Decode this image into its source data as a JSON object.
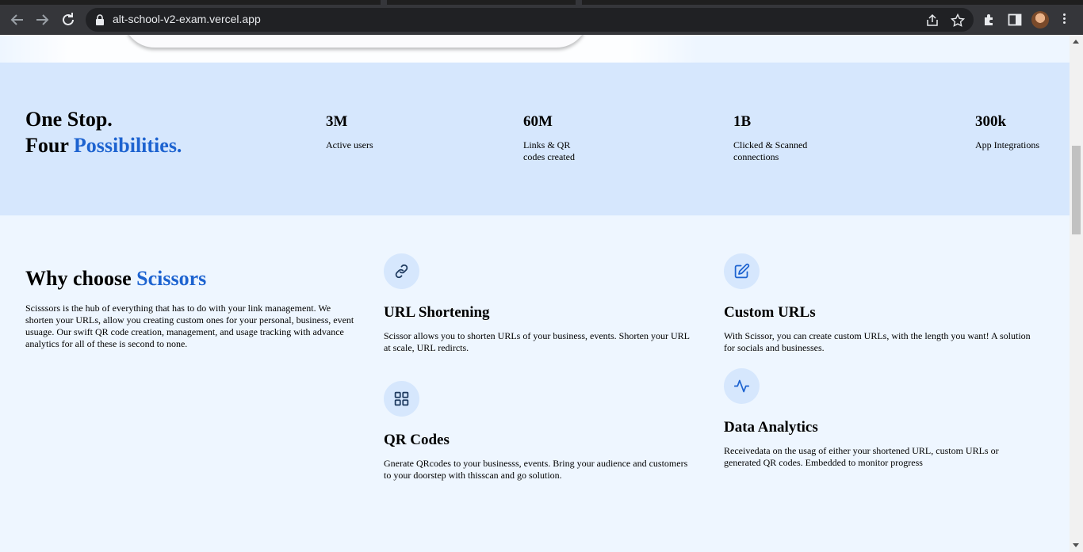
{
  "browser": {
    "url": "alt-school-v2-exam.vercel.app",
    "back_icon": "arrow-left-icon",
    "forward_icon": "arrow-right-icon",
    "reload_icon": "reload-icon"
  },
  "stats": {
    "headline_line1": "One Stop.",
    "headline_line2_prefix": "Four ",
    "headline_line2_accent": "Possibilities.",
    "items": [
      {
        "value": "3M",
        "label_line1": "Active users",
        "label_line2": ""
      },
      {
        "value": "60M",
        "label_line1": "Links & QR",
        "label_line2": "codes created"
      },
      {
        "value": "1B",
        "label_line1": "Clicked & Scanned",
        "label_line2": "connections"
      },
      {
        "value": "300k",
        "label_line1": "App Integrations",
        "label_line2": ""
      }
    ]
  },
  "why": {
    "title_prefix": "Why choose ",
    "title_accent": "Scissors",
    "body": "Scisssors is the hub of everything that has to do with your link management. We shorten your URLs, allow you creating custom ones for your personal, business, event usuage. Our swift QR code creation, management, and usage tracking with advance analytics for all of these is second to none."
  },
  "features": [
    {
      "icon": "link-icon",
      "title": "URL Shortening",
      "body": "Scissor allows you to shorten URLs of your business, events. Shorten your URL at scale, URL redircts."
    },
    {
      "icon": "edit-icon",
      "title": "Custom URLs",
      "body": "With Scissor, you can create custom URLs, with the length you want! A solution for socials and businesses."
    },
    {
      "icon": "qr-grid-icon",
      "title": "QR Codes",
      "body": "Gnerate QRcodes to your businesss, events. Bring your audience and customers to your doorstep with thisscan and go solution."
    },
    {
      "icon": "activity-icon",
      "title": "Data Analytics",
      "body": "Receivedata on the usag of either your shortened URL, custom URLs or generated QR codes. Embedded to monitor progress"
    }
  ],
  "colors": {
    "accent": "#1d63d0",
    "stats_bg": "#d6e7fd",
    "page_bg": "#eef6ff"
  }
}
